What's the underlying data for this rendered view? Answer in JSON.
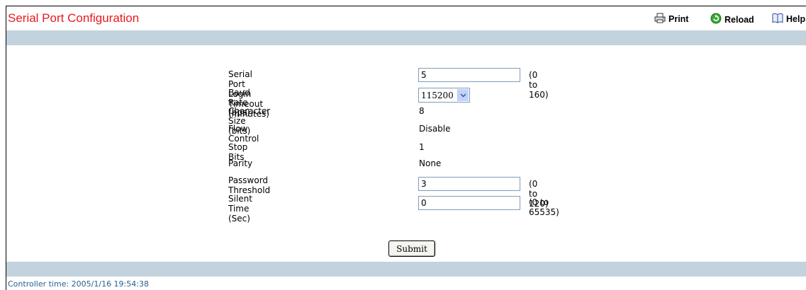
{
  "page": {
    "title": "Serial Port Configuration",
    "controller_time_label": "Controller time: 2005/1/16 19:54:38"
  },
  "toolbar": {
    "print_label": "Print",
    "reload_label": "Reload",
    "help_label": "Help"
  },
  "form": {
    "login_timeout": {
      "label": "Serial Port Login Timeout (minutes)",
      "value": "5",
      "range": "(0 to 160)"
    },
    "baud_rate": {
      "label": "Baud Rate (bps)",
      "value": "115200"
    },
    "character_size": {
      "label": "Character Size (bits)",
      "value": "8"
    },
    "flow_control": {
      "label": "Flow Control",
      "value": "Disable"
    },
    "stop_bits": {
      "label": "Stop Bits",
      "value": "1"
    },
    "parity": {
      "label": "Parity",
      "value": "None"
    },
    "password_threshold": {
      "label": "Password Threshold",
      "value": "3",
      "range": "(0 to 120)"
    },
    "silent_time": {
      "label": "Silent Time (Sec)",
      "value": "0",
      "range": "(0 to 65535)"
    },
    "submit_label": "Submit"
  },
  "colors": {
    "title": "#e8191e",
    "bar": "#c3d3de",
    "footer_text": "#2a5e92"
  },
  "icons": {
    "print": "printer-icon",
    "reload": "reload-icon",
    "help": "help-book-icon",
    "dropdown": "chevron-down-icon"
  }
}
